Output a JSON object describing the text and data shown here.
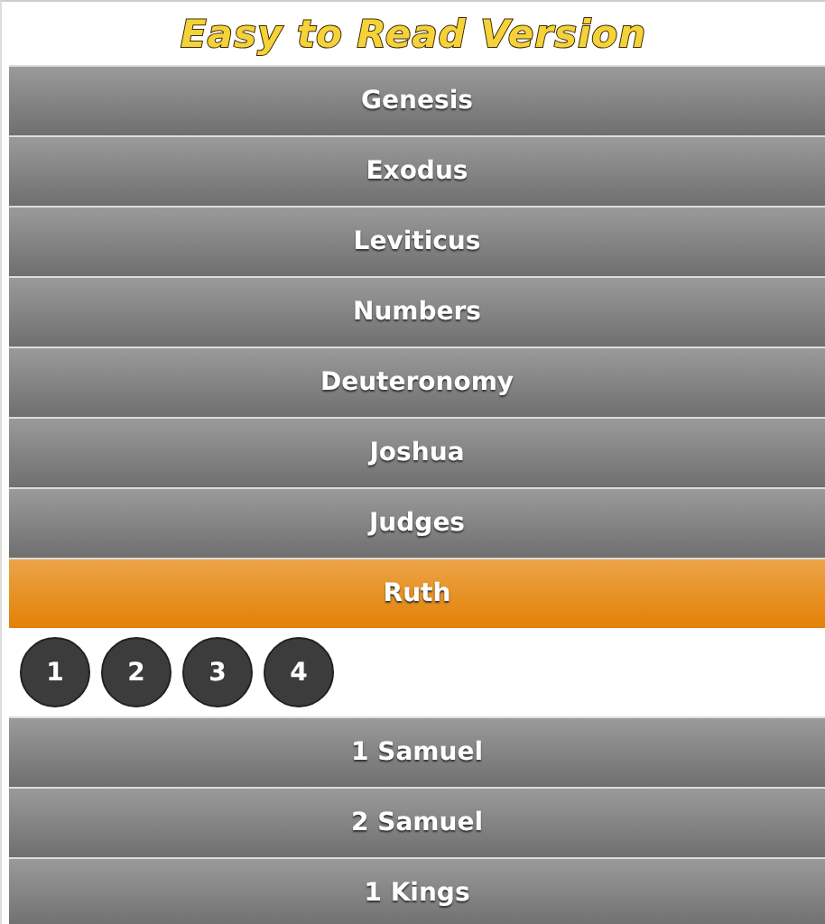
{
  "title": "Easy to Read Version",
  "books": [
    {
      "name": "Genesis",
      "selected": false
    },
    {
      "name": "Exodus",
      "selected": false
    },
    {
      "name": "Leviticus",
      "selected": false
    },
    {
      "name": "Numbers",
      "selected": false
    },
    {
      "name": "Deuteronomy",
      "selected": false
    },
    {
      "name": "Joshua",
      "selected": false
    },
    {
      "name": "Judges",
      "selected": false
    },
    {
      "name": "Ruth",
      "selected": true,
      "chapters": [
        "1",
        "2",
        "3",
        "4"
      ]
    },
    {
      "name": "1 Samuel",
      "selected": false
    },
    {
      "name": "2 Samuel",
      "selected": false
    },
    {
      "name": "1 Kings",
      "selected": false
    }
  ]
}
